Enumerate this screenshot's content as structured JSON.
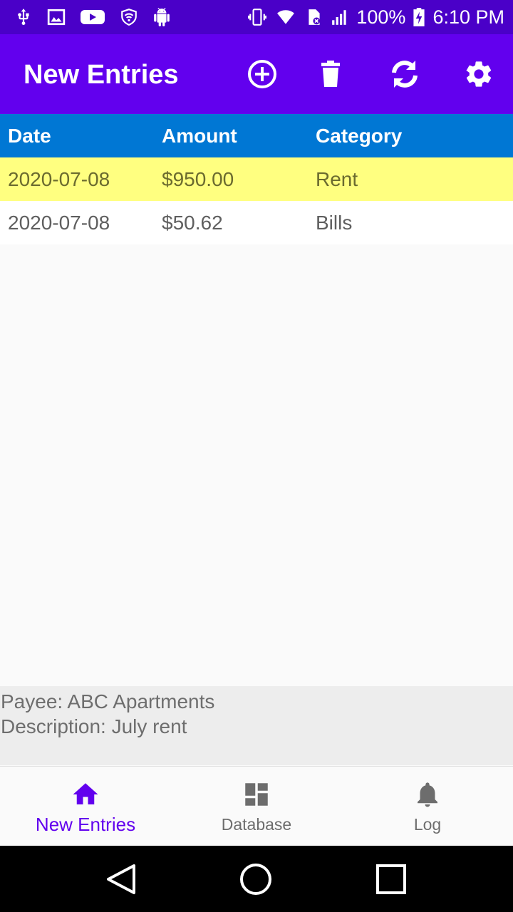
{
  "status_bar": {
    "left_icons": [
      "usb-icon",
      "image-icon",
      "youtube-icon",
      "shield-wifi-icon",
      "android-icon"
    ],
    "right_icons": [
      "vibrate-icon",
      "wifi-icon",
      "sim-icon",
      "signal-icon"
    ],
    "battery": "100%",
    "battery_icon": "battery-charging-icon",
    "time": "6:10 PM"
  },
  "app_bar": {
    "title": "New Entries",
    "actions": [
      "add-circle-icon",
      "delete-icon",
      "refresh-icon",
      "settings-icon"
    ],
    "background": "#6200ee"
  },
  "table": {
    "columns": [
      "Date",
      "Amount",
      "Category"
    ],
    "header_color": "#0077d4",
    "rows": [
      {
        "date": "2020-07-08",
        "amount": "$950.00",
        "category": "Rent",
        "selected": true
      },
      {
        "date": "2020-07-08",
        "amount": "$50.62",
        "category": "Bills",
        "selected": false
      }
    ],
    "highlight_color": "#ffff80"
  },
  "detail": {
    "payee": "Payee: ABC Apartments",
    "description": "Description: July rent"
  },
  "bottom_nav": {
    "items": [
      {
        "label": "New Entries",
        "icon": "home-icon",
        "active": true
      },
      {
        "label": "Database",
        "icon": "dashboard-icon",
        "active": false
      },
      {
        "label": "Log",
        "icon": "bell-icon",
        "active": false
      }
    ],
    "active_color": "#6200ee"
  },
  "system_nav": {
    "buttons": [
      "back-icon",
      "home-circle-icon",
      "recents-icon"
    ]
  }
}
